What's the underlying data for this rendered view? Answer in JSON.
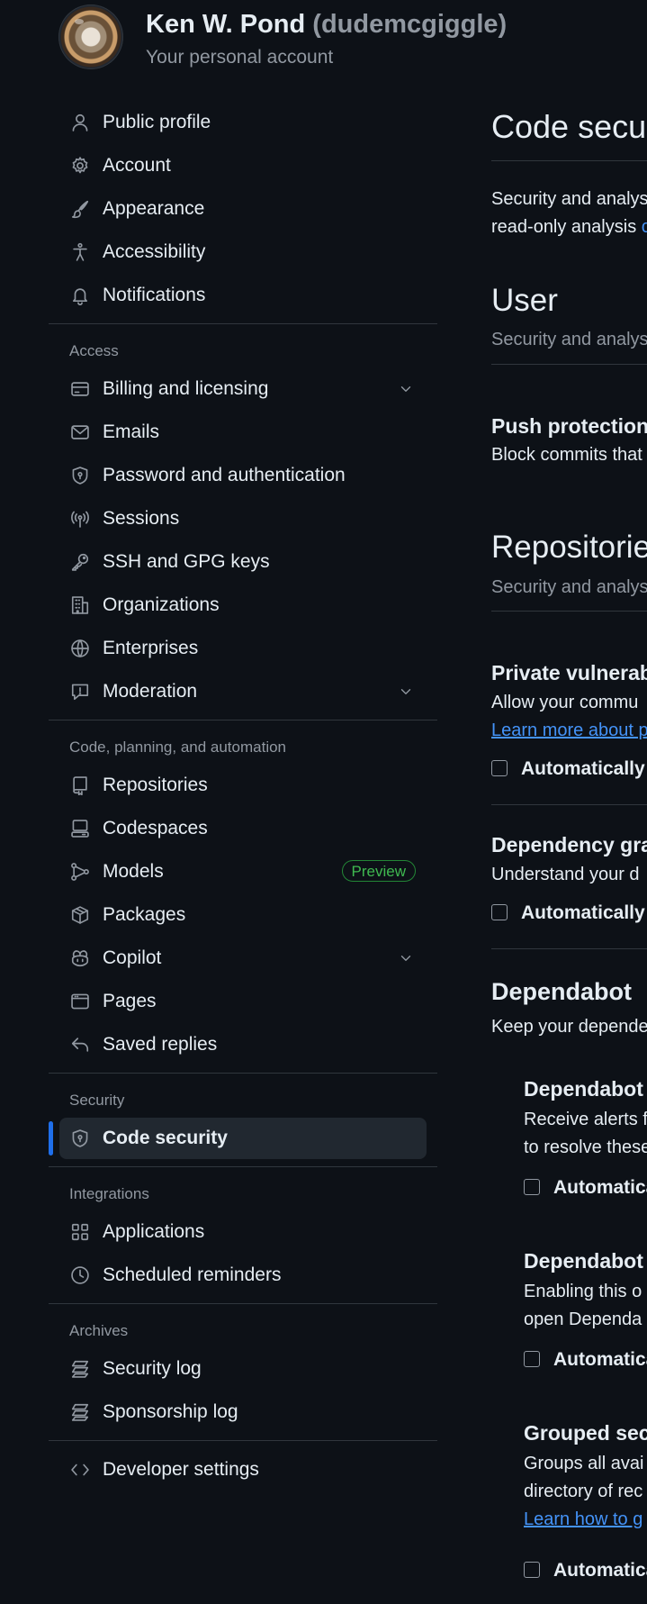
{
  "header": {
    "name": "Ken W. Pond",
    "login": "(dudemcgiggle)",
    "subtitle": "Your personal account"
  },
  "sidebar": {
    "top_items": [
      {
        "label": "Public profile",
        "icon": "person-icon"
      },
      {
        "label": "Account",
        "icon": "gear-icon"
      },
      {
        "label": "Appearance",
        "icon": "paintbrush-icon"
      },
      {
        "label": "Accessibility",
        "icon": "accessibility-icon"
      },
      {
        "label": "Notifications",
        "icon": "bell-icon"
      }
    ],
    "access": {
      "title": "Access",
      "items": [
        {
          "label": "Billing and licensing",
          "icon": "credit-card-icon",
          "expandable": true
        },
        {
          "label": "Emails",
          "icon": "mail-icon"
        },
        {
          "label": "Password and authentication",
          "icon": "shield-lock-icon"
        },
        {
          "label": "Sessions",
          "icon": "broadcast-icon"
        },
        {
          "label": "SSH and GPG keys",
          "icon": "key-icon"
        },
        {
          "label": "Organizations",
          "icon": "organization-icon"
        },
        {
          "label": "Enterprises",
          "icon": "globe-icon"
        },
        {
          "label": "Moderation",
          "icon": "report-icon",
          "expandable": true
        }
      ]
    },
    "code": {
      "title": "Code, planning, and automation",
      "items": [
        {
          "label": "Repositories",
          "icon": "repo-icon"
        },
        {
          "label": "Codespaces",
          "icon": "codespaces-icon"
        },
        {
          "label": "Models",
          "icon": "models-icon",
          "badge": "Preview"
        },
        {
          "label": "Packages",
          "icon": "package-icon"
        },
        {
          "label": "Copilot",
          "icon": "copilot-icon",
          "expandable": true
        },
        {
          "label": "Pages",
          "icon": "browser-icon"
        },
        {
          "label": "Saved replies",
          "icon": "reply-icon"
        }
      ]
    },
    "security": {
      "title": "Security",
      "items": [
        {
          "label": "Code security",
          "icon": "shield-lock-icon",
          "selected": true
        }
      ]
    },
    "integrations": {
      "title": "Integrations",
      "items": [
        {
          "label": "Applications",
          "icon": "apps-icon"
        },
        {
          "label": "Scheduled reminders",
          "icon": "clock-icon"
        }
      ]
    },
    "archives": {
      "title": "Archives",
      "items": [
        {
          "label": "Security log",
          "icon": "log-icon"
        },
        {
          "label": "Sponsorship log",
          "icon": "log-icon"
        }
      ]
    },
    "developer": {
      "label": "Developer settings",
      "icon": "code-icon"
    }
  },
  "content": {
    "title": "Code secur",
    "intro_line1": "Security and analys",
    "intro_line2_a": "read-only analysis ",
    "intro_line2_b": "c",
    "user_heading": "User",
    "user_sub": "Security and analys",
    "push_title": "Push protection",
    "push_desc": "Block commits that",
    "repos_heading": "Repositorie",
    "repos_sub": "Security and analys",
    "pvr_title": "Private vulnerab",
    "pvr_desc": "Allow your commu",
    "pvr_link": "Learn more about p",
    "pvr_check": "Automatically e",
    "dep_graph_title": "Dependency gra",
    "dep_graph_desc": "Understand your d",
    "dep_graph_check": "Automatically e",
    "dependabot_title": "Dependabot",
    "dependabot_desc": "Keep your depende",
    "alerts_title": "Dependabot",
    "alerts_desc1": "Receive alerts f",
    "alerts_desc2": "to resolve these",
    "alerts_check": "Automatica",
    "sec_updates_title": "Dependabot",
    "sec_updates_desc1": "Enabling this o",
    "sec_updates_desc2": "open Dependa",
    "sec_updates_check": "Automatica",
    "grouped_title": "Grouped sec",
    "grouped_desc1": "Groups all avai",
    "grouped_desc2": "directory of rec",
    "grouped_link": "Learn how to g",
    "grouped_check": "Automatica"
  }
}
